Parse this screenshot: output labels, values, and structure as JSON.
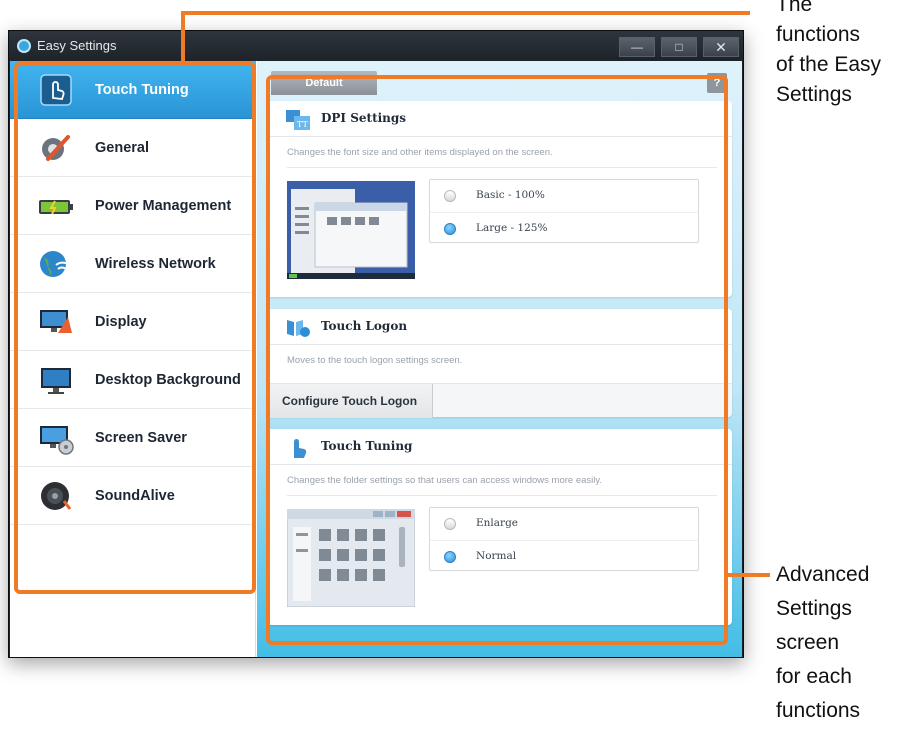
{
  "window": {
    "title": "Easy Settings",
    "min_glyph": "—",
    "max_glyph": "□"
  },
  "sidebar": {
    "items": [
      {
        "label": "Touch Tuning",
        "icon": "touch-finger-icon",
        "active": true
      },
      {
        "label": "General",
        "icon": "general-gear-icon",
        "active": false
      },
      {
        "label": "Power Management",
        "icon": "battery-icon",
        "active": false
      },
      {
        "label": "Wireless Network",
        "icon": "globe-wifi-icon",
        "active": false
      },
      {
        "label": "Display",
        "icon": "display-monitor-icon",
        "active": false
      },
      {
        "label": "Desktop Background",
        "icon": "desktop-monitor-icon",
        "active": false
      },
      {
        "label": "Screen Saver",
        "icon": "screen-saver-icon",
        "active": false
      },
      {
        "label": "SoundAlive",
        "icon": "speaker-icon",
        "active": false
      }
    ]
  },
  "main": {
    "default_label": "Default",
    "help_label": "?",
    "dpi": {
      "title": "DPI Settings",
      "description": "Changes the font size and other items displayed on the screen.",
      "options": [
        {
          "label": "Basic - 100%",
          "selected": false
        },
        {
          "label": "Large - 125%",
          "selected": true
        }
      ]
    },
    "touch_logon": {
      "title": "Touch Logon",
      "description": "Moves to the touch logon settings screen.",
      "button_label": "Configure Touch Logon"
    },
    "touch_tuning": {
      "title": "Touch Tuning",
      "description": "Changes the folder settings so that users can access windows more easily.",
      "options": [
        {
          "label": "Enlarge",
          "selected": false
        },
        {
          "label": "Normal",
          "selected": true
        }
      ]
    }
  },
  "annotations": {
    "top_right": [
      "The",
      "functions",
      "of the Easy",
      "Settings"
    ],
    "bottom_right": [
      "Advanced",
      "Settings",
      "screen",
      "for each",
      "functions"
    ]
  },
  "colors": {
    "accent_active": "#2a94d6",
    "annotation": "#f07b27",
    "titlebar": "#1d2329"
  }
}
